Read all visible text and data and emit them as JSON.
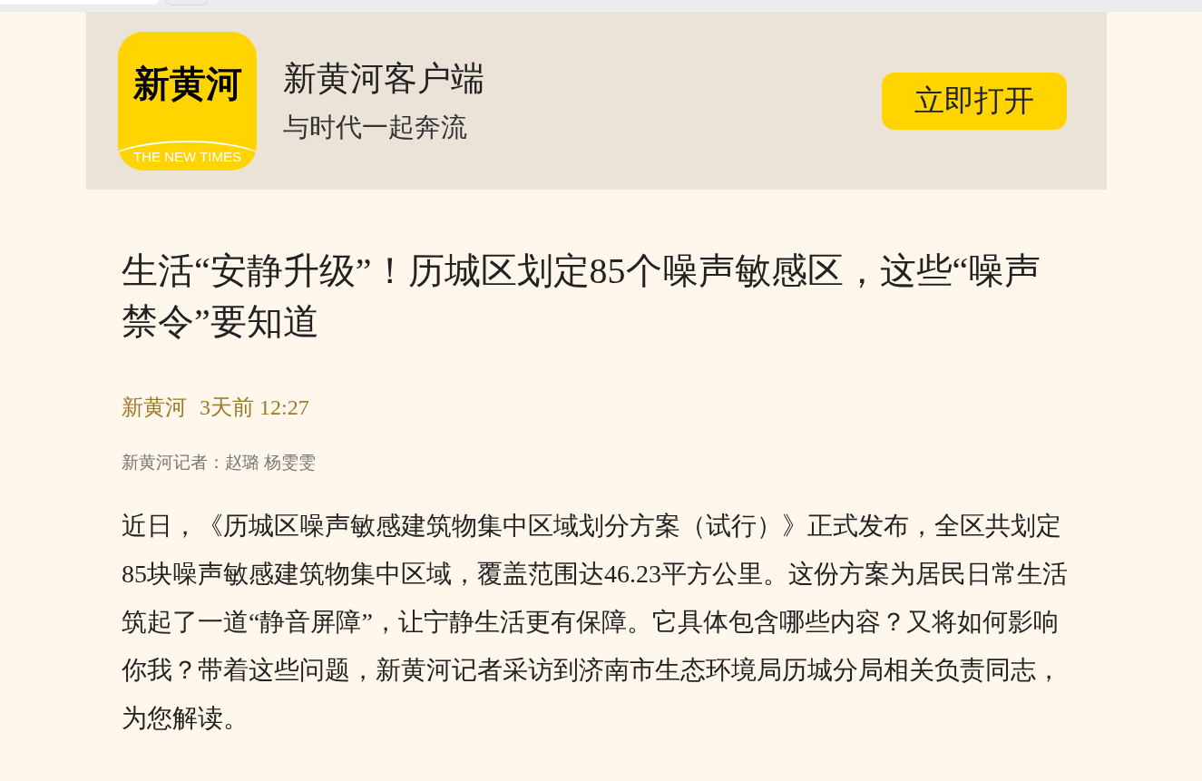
{
  "app_banner": {
    "logo": {
      "mark": "新黄河",
      "tagline": "THE NEW TIMES"
    },
    "title": "新黄河客户端",
    "slogan": "与时代一起奔流",
    "open_button": "立即打开"
  },
  "article": {
    "headline": "生活“安静升级”！历城区划定85个噪声敏感区，这些“噪声禁令”要知道",
    "source": "新黄河",
    "time": "3天前 12:27",
    "byline": "新黄河记者：赵璐 杨雯雯",
    "paragraphs": [
      "近日，《历城区噪声敏感建筑物集中区域划分方案（试行）》正式发布，全区共划定85块噪声敏感建筑物集中区域，覆盖范围达46.23平方公里。这份方案为居民日常生活筑起了一道“静音屏障”，让宁静生活更有保障。它具体包含哪些内容？又将如何影响你我？带着这些问题，新黄河记者采访到济南市生态环境局历城分局相关负责同志，为您解读。"
    ]
  }
}
